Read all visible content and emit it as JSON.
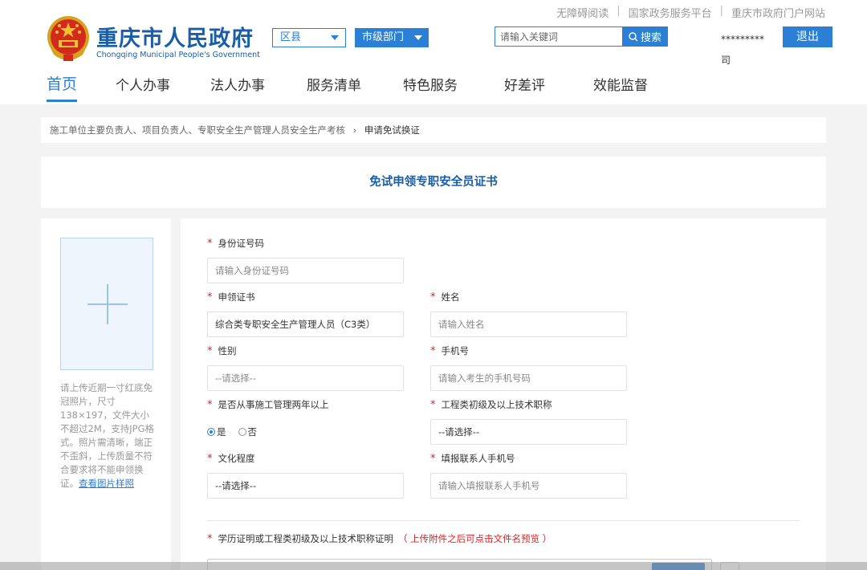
{
  "top_links": [
    "无障碍阅读",
    "国家政务服务平台",
    "重庆市政府门户网站"
  ],
  "logo": {
    "title": "重庆市人民政府",
    "subtitle": "Chongqing Municipal People's Government"
  },
  "selectors": {
    "district": "区县",
    "department": "市级部门"
  },
  "search": {
    "placeholder": "请输入关键词",
    "button": "搜索"
  },
  "user": {
    "name": "*********司",
    "logout": "退出"
  },
  "nav": [
    "首页",
    "个人办事",
    "法人办事",
    "服务清单",
    "特色服务",
    "好差评",
    "效能监督"
  ],
  "breadcrumb": {
    "parent": "施工单位主要负责人、项目负责人、专职安全生产管理人员安全生产考核",
    "current": "申请免试换证"
  },
  "page_title": "免试申领专职安全员证书",
  "photo": {
    "tip": "请上传近期一寸红底免冠照片，尺寸138×197，文件大小不超过2M，支持JPG格式。照片需清晰，端正不歪斜，上传质量不符合要求将不能申领换证。",
    "sample_link": "查看图片样照"
  },
  "form": {
    "id_number": {
      "label": "身份证号码",
      "placeholder": "请输入身份证号码"
    },
    "certificate": {
      "label": "申领证书",
      "value": "综合类专职安全生产管理人员（C3类）"
    },
    "name": {
      "label": "姓名",
      "placeholder": "请输入姓名"
    },
    "gender": {
      "label": "性别",
      "value": "--请选择--"
    },
    "phone": {
      "label": "手机号",
      "placeholder": "请输入考生的手机号码"
    },
    "experience": {
      "label": "是否从事施工管理两年以上",
      "yes": "是",
      "no": "否",
      "selected": "是"
    },
    "title_level": {
      "label": "工程类初级及以上技术职称",
      "value": "--请选择--"
    },
    "education": {
      "label": "文化程度",
      "value": "--请选择--"
    },
    "contact_phone": {
      "label": "填报联系人手机号",
      "placeholder": "请输入填报联系人手机号"
    },
    "attachment": {
      "label": "学历证明或工程类初级及以上技术职称证明",
      "note": "（ 上传附件之后可点击文件名预览 ）"
    }
  },
  "colors": {
    "brand_blue": "#2b7fd4",
    "title_blue": "#1a5ea8",
    "required_red": "#e02020"
  }
}
